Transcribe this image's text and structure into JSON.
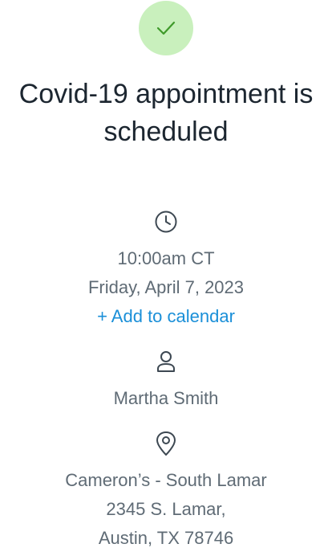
{
  "status": {
    "icon": "checkmark-icon",
    "color": "#c9f0bd"
  },
  "title": {
    "line1": "Covid-19 appointment is",
    "line2": "scheduled"
  },
  "appointment": {
    "time_icon": "clock-icon",
    "time": "10:00am CT",
    "date": "Friday, April 7, 2023",
    "add_to_calendar": "+ Add to calendar",
    "person_icon": "person-icon",
    "person": "Martha Smith",
    "location_icon": "location-pin-icon",
    "location_name": "Cameron’s - South Lamar",
    "address_line1": "2345 S. Lamar,",
    "address_line2": "Austin, TX 78746"
  },
  "colors": {
    "link": "#1a8fd8",
    "text": "#5f6b75",
    "title": "#1c2630"
  }
}
